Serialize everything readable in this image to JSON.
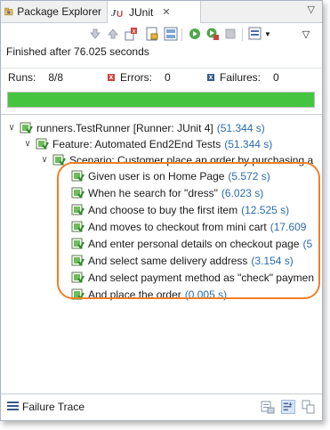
{
  "tabs": {
    "package_explorer": "Package Explorer",
    "junit": "JUnit",
    "close_symbol": "✕"
  },
  "status": {
    "finished": "Finished after 76.025 seconds"
  },
  "counters": {
    "runs_label": "Runs:",
    "runs_value": "8/8",
    "errors_label": "Errors:",
    "errors_value": "0",
    "failures_label": "Failures:",
    "failures_value": "0"
  },
  "progress": {
    "fraction": 1.0,
    "color": "#45c53f"
  },
  "tree": {
    "runner": {
      "label": "runners.TestRunner [Runner: JUnit 4]",
      "time": "(51.344 s)"
    },
    "feature": {
      "label": "Feature: Automated End2End Tests",
      "time": "(51.344 s)"
    },
    "scenario": {
      "label": "Scenario: Customer place an order by purchasing a"
    },
    "steps": [
      {
        "label": "Given user is on Home Page",
        "time": "(5.572 s)"
      },
      {
        "label": "When he search for \"dress\"",
        "time": "(6.023 s)"
      },
      {
        "label": "And choose to buy the first item",
        "time": "(12.525 s)"
      },
      {
        "label": "And moves to checkout from mini cart",
        "time": "(17.609"
      },
      {
        "label": "And enter personal details on checkout page",
        "time": "(5"
      },
      {
        "label": "And select same delivery address",
        "time": "(3.154 s)"
      },
      {
        "label": "And select payment method as \"check\" paymen",
        "time": ""
      },
      {
        "label": "And place the order",
        "time": "(0.005 s)"
      }
    ]
  },
  "bottom": {
    "failure_trace": "Failure Trace"
  },
  "icons": {
    "package_explorer": "package-explorer-icon",
    "junit": "junit-icon",
    "next_failure": "next-failure-icon",
    "previous_failure": "previous-failure-icon",
    "show_failures_only": "show-failures-only-icon",
    "scroll_lock": "scroll-lock-icon",
    "rerun": "rerun-icon",
    "rerun_failed": "rerun-failed-first-icon",
    "stop": "stop-icon",
    "history": "test-run-history-icon",
    "view_menu": "view-menu-icon",
    "test_ok": "test-passed-icon",
    "filter_stack": "filter-stack-trace-icon",
    "compare": "compare-results-icon",
    "copy_trace": "copy-trace-icon"
  },
  "colors": {
    "highlight": "#ef7f27",
    "time": "#2a6cad"
  }
}
